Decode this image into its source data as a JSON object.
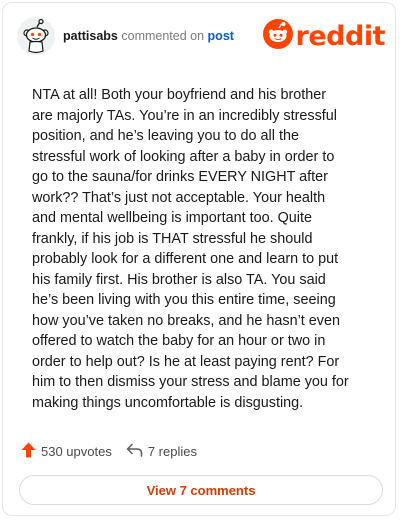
{
  "header": {
    "username": "pattisabs",
    "commented_text": "commented on",
    "post_link": "post",
    "brand_name": "reddit",
    "avatar_icon": "snoo-avatar-icon",
    "brand_icon": "reddit-logo-icon"
  },
  "comment": {
    "body": "NTA at all! Both your boyfriend and his brother\nare majorly TAs. You’re in an incredibly stressful\nposition, and he’s leaving you to do all the\nstressful work of looking after a baby in order to\ngo to the sauna/for drinks EVERY NIGHT after\nwork?? That’s just not acceptable. Your health\nand mental wellbeing is important too. Quite\nfrankly, if his job is THAT stressful he should\nprobably look for a different one and learn to put\nhis family first. His brother is also TA. You said\nhe’s been living with you this entire time, seeing\nhow you’ve taken no breaks, and he hasn’t even\noffered to watch the baby for an hour or two in\norder to help out? Is he at least paying rent? For\nhim to then dismiss your stress and blame you for\nmaking things uncomfortable is disgusting."
  },
  "actions": {
    "upvotes_label": "530 upvotes",
    "replies_label": "7 replies",
    "upvote_icon": "upvote-arrow-icon",
    "reply_icon": "reply-icon"
  },
  "footer": {
    "view_comments_label": "View 7 comments"
  },
  "colors": {
    "brand_orange": "#ff4500",
    "link_blue": "#0b5bd3",
    "button_text": "#d93a00"
  }
}
